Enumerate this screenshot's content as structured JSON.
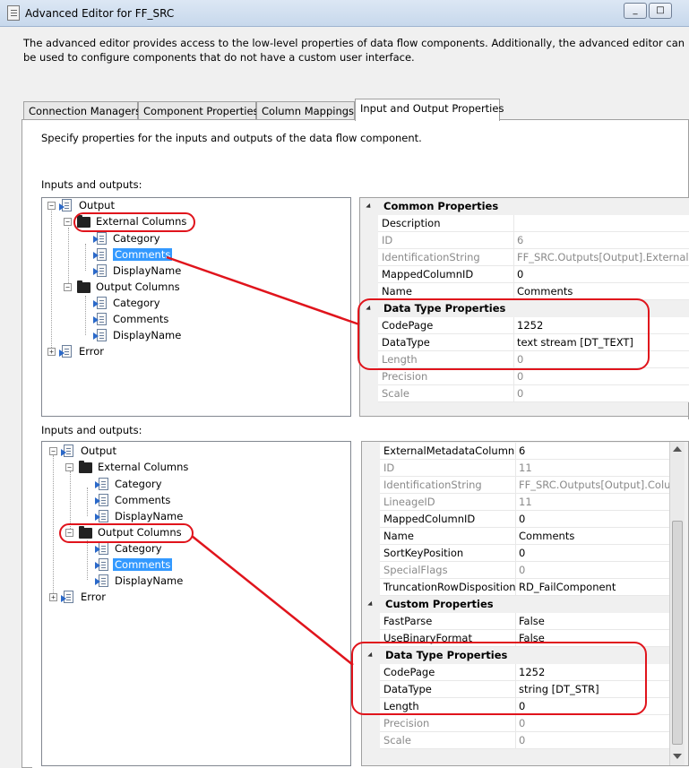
{
  "window": {
    "title": "Advanced Editor for FF_SRC",
    "minimize": "_",
    "maximize": "□"
  },
  "dialog": {
    "description": "The advanced editor provides access to the low-level properties of data flow components. Additionally, the advanced editor can be used to configure components that do not have a custom user interface."
  },
  "tabs": [
    {
      "label": "Connection Managers"
    },
    {
      "label": "Component Properties"
    },
    {
      "label": "Column Mappings"
    },
    {
      "label": "Input and Output Properties"
    }
  ],
  "panel": {
    "description": "Specify properties for the inputs and outputs of the data flow component."
  },
  "top": {
    "label": "Inputs and outputs:",
    "tree": {
      "output": "Output",
      "external_columns": "External Columns",
      "ext_items": [
        "Category",
        "Comments",
        "DisplayName"
      ],
      "output_columns": "Output Columns",
      "out_items": [
        "Category",
        "Comments",
        "DisplayName"
      ],
      "error": "Error"
    },
    "grid": {
      "common": "Common Properties",
      "rows1": [
        {
          "name": "Description",
          "value": ""
        },
        {
          "name": "ID",
          "value": "6"
        },
        {
          "name": "IdentificationString",
          "value": "FF_SRC.Outputs[Output].ExternalColumns[Comments]"
        },
        {
          "name": "MappedColumnID",
          "value": "0"
        },
        {
          "name": "Name",
          "value": "Comments"
        }
      ],
      "datatype": "Data Type Properties",
      "rows2": [
        {
          "name": "CodePage",
          "value": "1252"
        },
        {
          "name": "DataType",
          "value": "text stream [DT_TEXT]"
        },
        {
          "name": "Length",
          "value": "0"
        },
        {
          "name": "Precision",
          "value": "0"
        },
        {
          "name": "Scale",
          "value": "0"
        }
      ]
    }
  },
  "bottom": {
    "label": "Inputs and outputs:",
    "tree": {
      "output": "Output",
      "external_columns": "External Columns",
      "ext_items": [
        "Category",
        "Comments",
        "DisplayName"
      ],
      "output_columns": "Output Columns",
      "out_items": [
        "Category",
        "Comments",
        "DisplayName"
      ],
      "error": "Error"
    },
    "grid": {
      "rows1": [
        {
          "name": "ExternalMetadataColumnID",
          "value": "6"
        },
        {
          "name": "ID",
          "value": "11"
        },
        {
          "name": "IdentificationString",
          "value": "FF_SRC.Outputs[Output].Columns[Comments]"
        },
        {
          "name": "LineageID",
          "value": "11"
        },
        {
          "name": "MappedColumnID",
          "value": "0"
        },
        {
          "name": "Name",
          "value": "Comments"
        },
        {
          "name": "SortKeyPosition",
          "value": "0"
        },
        {
          "name": "SpecialFlags",
          "value": "0"
        },
        {
          "name": "TruncationRowDisposition",
          "value": "RD_FailComponent"
        }
      ],
      "custom": "Custom Properties",
      "rows2": [
        {
          "name": "FastParse",
          "value": "False"
        },
        {
          "name": "UseBinaryFormat",
          "value": "False"
        }
      ],
      "datatype": "Data Type Properties",
      "rows3": [
        {
          "name": "CodePage",
          "value": "1252"
        },
        {
          "name": "DataType",
          "value": "string [DT_STR]"
        },
        {
          "name": "Length",
          "value": "0"
        },
        {
          "name": "Precision",
          "value": "0"
        },
        {
          "name": "Scale",
          "value": "0"
        }
      ]
    }
  },
  "colors": {
    "selection": "#3399ff",
    "annotation": "#e0141c"
  }
}
